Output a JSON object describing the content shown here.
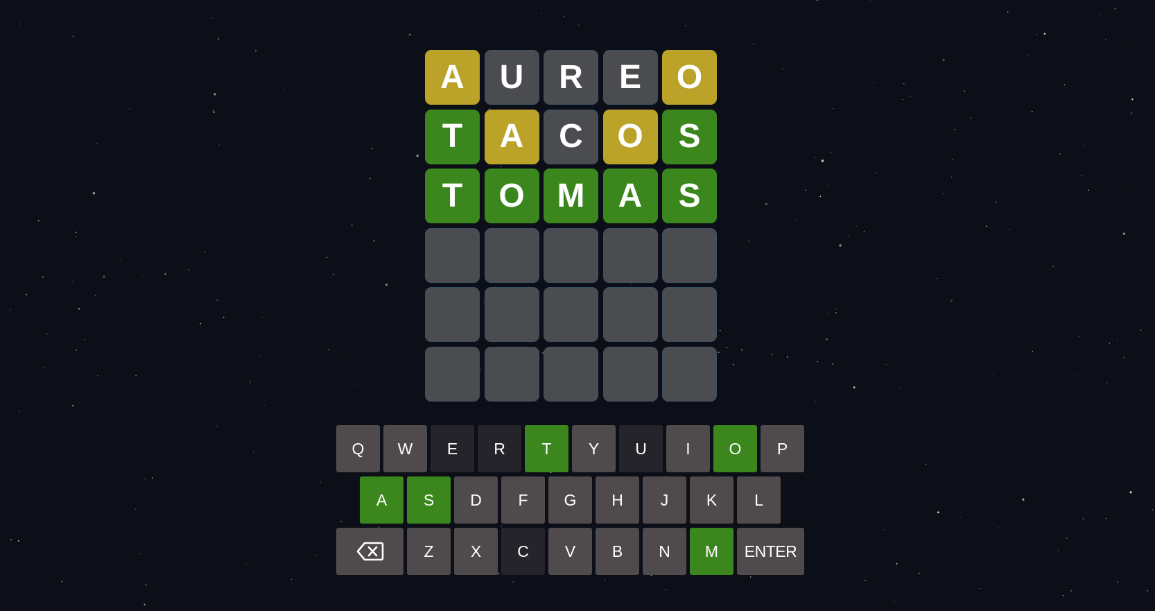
{
  "colors": {
    "background": "#0c0f18",
    "correct": "#3b861d",
    "present": "#bba32a",
    "tile_empty": "#4b4c4f",
    "key_default": "#4f4a4b",
    "key_absent": "#25242b",
    "tile_border": "#3d5266"
  },
  "board": {
    "rows": [
      [
        {
          "letter": "A",
          "state": "present"
        },
        {
          "letter": "U",
          "state": "absent"
        },
        {
          "letter": "R",
          "state": "absent"
        },
        {
          "letter": "E",
          "state": "absent"
        },
        {
          "letter": "O",
          "state": "present"
        }
      ],
      [
        {
          "letter": "T",
          "state": "correct"
        },
        {
          "letter": "A",
          "state": "present"
        },
        {
          "letter": "C",
          "state": "absent"
        },
        {
          "letter": "O",
          "state": "present"
        },
        {
          "letter": "S",
          "state": "correct"
        }
      ],
      [
        {
          "letter": "T",
          "state": "correct"
        },
        {
          "letter": "O",
          "state": "correct"
        },
        {
          "letter": "M",
          "state": "correct"
        },
        {
          "letter": "A",
          "state": "correct"
        },
        {
          "letter": "S",
          "state": "correct"
        }
      ],
      [
        {
          "letter": "",
          "state": "empty"
        },
        {
          "letter": "",
          "state": "empty"
        },
        {
          "letter": "",
          "state": "empty"
        },
        {
          "letter": "",
          "state": "empty"
        },
        {
          "letter": "",
          "state": "empty"
        }
      ],
      [
        {
          "letter": "",
          "state": "empty"
        },
        {
          "letter": "",
          "state": "empty"
        },
        {
          "letter": "",
          "state": "empty"
        },
        {
          "letter": "",
          "state": "empty"
        },
        {
          "letter": "",
          "state": "empty"
        }
      ],
      [
        {
          "letter": "",
          "state": "empty"
        },
        {
          "letter": "",
          "state": "empty"
        },
        {
          "letter": "",
          "state": "empty"
        },
        {
          "letter": "",
          "state": "empty"
        },
        {
          "letter": "",
          "state": "empty"
        }
      ]
    ]
  },
  "keyboard": {
    "rows": [
      [
        {
          "label": "Q",
          "state": "default"
        },
        {
          "label": "W",
          "state": "default"
        },
        {
          "label": "E",
          "state": "absent"
        },
        {
          "label": "R",
          "state": "absent"
        },
        {
          "label": "T",
          "state": "correct"
        },
        {
          "label": "Y",
          "state": "default"
        },
        {
          "label": "U",
          "state": "absent"
        },
        {
          "label": "I",
          "state": "default"
        },
        {
          "label": "O",
          "state": "correct"
        },
        {
          "label": "P",
          "state": "default"
        }
      ],
      [
        {
          "label": "A",
          "state": "correct"
        },
        {
          "label": "S",
          "state": "correct"
        },
        {
          "label": "D",
          "state": "default"
        },
        {
          "label": "F",
          "state": "default"
        },
        {
          "label": "G",
          "state": "default"
        },
        {
          "label": "H",
          "state": "default"
        },
        {
          "label": "J",
          "state": "default"
        },
        {
          "label": "K",
          "state": "default"
        },
        {
          "label": "L",
          "state": "default"
        }
      ],
      [
        {
          "label": "",
          "state": "default",
          "icon": "backspace-icon",
          "wide": true
        },
        {
          "label": "Z",
          "state": "default"
        },
        {
          "label": "X",
          "state": "default"
        },
        {
          "label": "C",
          "state": "absent"
        },
        {
          "label": "V",
          "state": "default"
        },
        {
          "label": "B",
          "state": "default"
        },
        {
          "label": "N",
          "state": "default"
        },
        {
          "label": "M",
          "state": "correct"
        },
        {
          "label": "ENTER",
          "state": "default",
          "wide": true
        }
      ]
    ]
  }
}
